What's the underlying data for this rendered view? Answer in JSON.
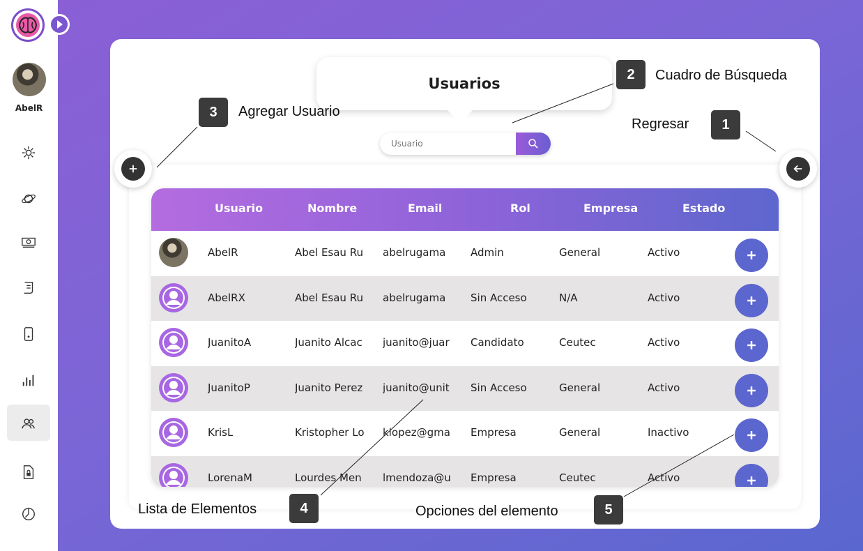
{
  "sidebar": {
    "user_name": "AbelR",
    "icons": [
      "gear-icon",
      "planet-icon",
      "money-icon",
      "receipt-icon",
      "phone-icon",
      "bar-chart-icon",
      "users-icon",
      "file-lock-icon",
      "clock-icon"
    ],
    "active_item": "users-icon"
  },
  "main": {
    "title": "Usuarios",
    "search": {
      "placeholder": "Usuario"
    },
    "colors": {
      "header_gradient_start": "#b46ce0",
      "header_gradient_end": "#5d67cd",
      "add_button": "#5b66cf",
      "back_button": "#333333"
    }
  },
  "table": {
    "headers": [
      "Usuario",
      "Nombre",
      "Email",
      "Rol",
      "Empresa",
      "Estado"
    ],
    "rows": [
      {
        "avatar": "photo",
        "usuario": "AbelR",
        "nombre": "Abel Esau Ru",
        "email": "abelrugama",
        "rol": "Admin",
        "empresa": "General",
        "estado": "Activo"
      },
      {
        "avatar": "generic",
        "usuario": "AbelRX",
        "nombre": "Abel Esau Ru",
        "email": "abelrugama",
        "rol": "Sin Acceso",
        "empresa": "N/A",
        "estado": "Activo"
      },
      {
        "avatar": "generic",
        "usuario": "JuanitoA",
        "nombre": "Juanito Alcac",
        "email": "juanito@juar",
        "rol": "Candidato",
        "empresa": "Ceutec",
        "estado": "Activo"
      },
      {
        "avatar": "generic",
        "usuario": "JuanitoP",
        "nombre": "Juanito Perez",
        "email": "juanito@unit",
        "rol": "Sin Acceso",
        "empresa": "General",
        "estado": "Activo"
      },
      {
        "avatar": "generic",
        "usuario": "KrisL",
        "nombre": "Kristopher Lo",
        "email": "klopez@gma",
        "rol": "Empresa",
        "empresa": "General",
        "estado": "Inactivo"
      },
      {
        "avatar": "generic",
        "usuario": "LorenaM",
        "nombre": "Lourdes Men",
        "email": "lmendoza@u",
        "rol": "Empresa",
        "empresa": "Ceutec",
        "estado": "Activo"
      }
    ]
  },
  "callouts": [
    {
      "number": "1",
      "label": "Regresar"
    },
    {
      "number": "2",
      "label": "Cuadro de Búsqueda"
    },
    {
      "number": "3",
      "label": "Agregar Usuario"
    },
    {
      "number": "4",
      "label": "Lista de Elementos"
    },
    {
      "number": "5",
      "label": "Opciones del elemento"
    }
  ]
}
